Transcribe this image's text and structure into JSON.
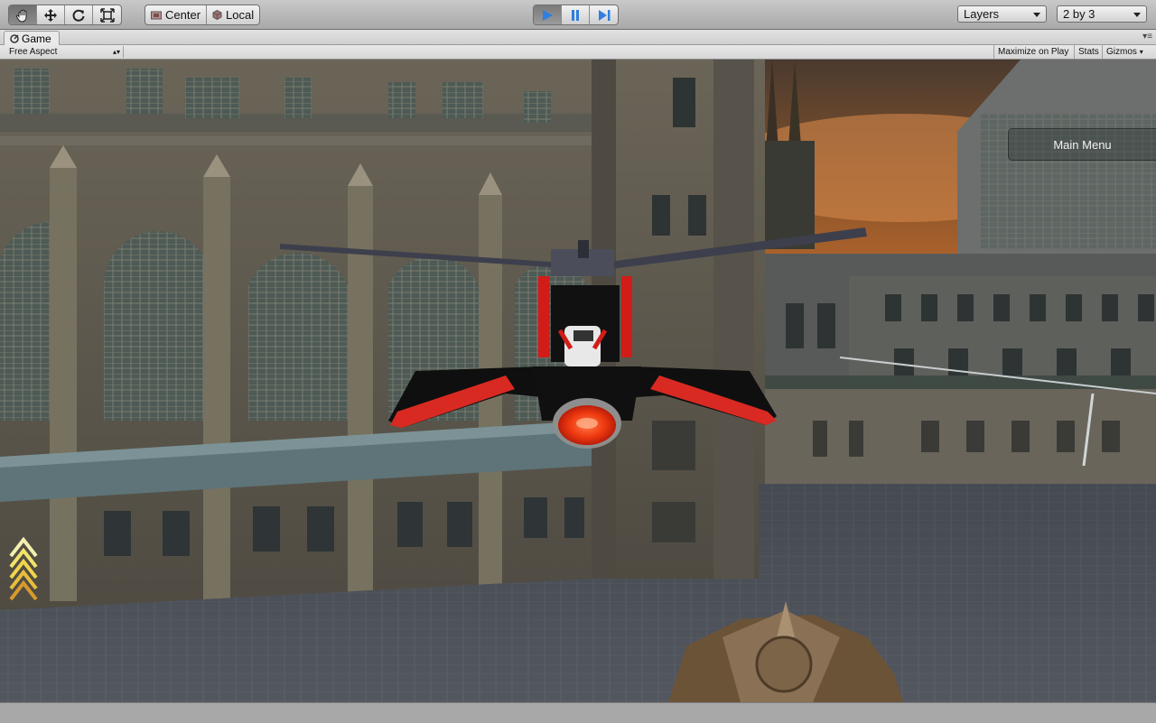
{
  "toolbar": {
    "tools": [
      {
        "name": "hand-tool",
        "active": true
      },
      {
        "name": "move-tool",
        "active": false
      },
      {
        "name": "rotate-tool",
        "active": false
      },
      {
        "name": "scale-tool",
        "active": false
      }
    ],
    "pivot_mode": "Center",
    "pivot_rotation": "Local",
    "playback": {
      "play_active": true,
      "pause_active": false
    },
    "layers_label": "Layers",
    "layout_label": "2 by 3"
  },
  "game_window": {
    "tab_title": "Game",
    "aspect": "Free Aspect",
    "maximize_label": "Maximize on Play",
    "stats_label": "Stats",
    "gizmos_label": "Gizmos"
  },
  "hud": {
    "main_menu_label": "Main Menu"
  },
  "colors": {
    "accent_play": "#2f7fe0",
    "toolbar_bg": "#b9b9b9",
    "sky_orange": "#c76a2a",
    "helicopter_red": "#e0211b"
  }
}
